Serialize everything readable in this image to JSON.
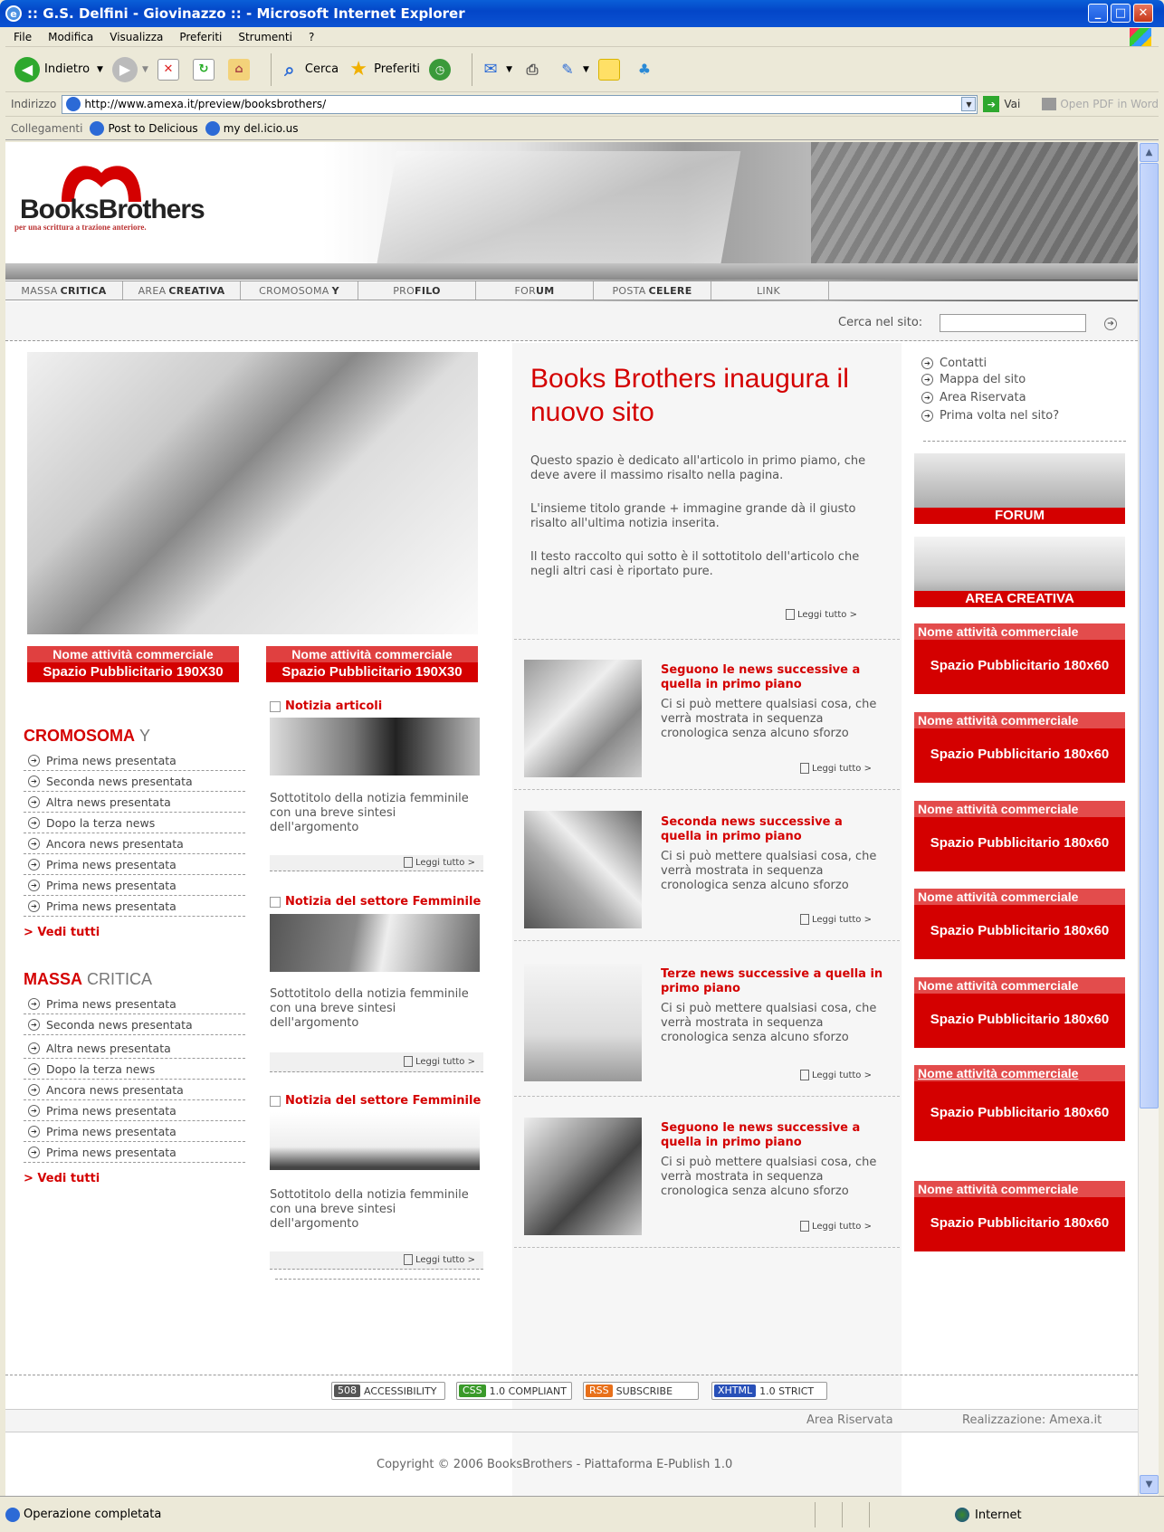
{
  "window": {
    "title": ":: G.S. Delfini - Giovinazzo :: - Microsoft Internet Explorer"
  },
  "menu": [
    "File",
    "Modifica",
    "Visualizza",
    "Preferiti",
    "Strumenti",
    "?"
  ],
  "toolbar": {
    "back": "Indietro",
    "search": "Cerca",
    "favorites": "Preferiti"
  },
  "address": {
    "label": "Indirizzo",
    "url": "http://www.amexa.it/preview/booksbrothers/",
    "go": "Vai",
    "pdf": "Open PDF in Word"
  },
  "links": {
    "label": "Collegamenti",
    "items": [
      "Post to Delicious",
      "my del.icio.us"
    ]
  },
  "site": {
    "logo": "BooksBrothers",
    "tagline": "per una scrittura a trazione anteriore.",
    "nav": [
      {
        "light": "MASSA",
        "bold": "CRITICA"
      },
      {
        "light": "AREA",
        "bold": "CREATIVA"
      },
      {
        "light": "CROMOSOMA",
        "bold": "Y"
      },
      {
        "light": "PRO",
        "bold": "FILO"
      },
      {
        "light": "FOR",
        "bold": "UM"
      },
      {
        "light": "POSTA",
        "bold": "CELERE"
      },
      {
        "light": "LINK",
        "bold": ""
      }
    ],
    "search_label": "Cerca nel sito:"
  },
  "ads190": [
    {
      "l1": "Nome attività commerciale",
      "l2": "Spazio Pubblicitario 190X30"
    },
    {
      "l1": "Nome attività commerciale",
      "l2": "Spazio Pubblicitario 190X30"
    }
  ],
  "cromosoma": {
    "red": "CROMOSOMA",
    "grey": "Y",
    "items": [
      "Prima news presentata",
      "Seconda news presentata",
      "Altra news presentata",
      "Dopo la terza news",
      "Ancora news presentata",
      "Prima news presentata",
      "Prima news presentata",
      "Prima news presentata"
    ],
    "more": "> Vedi tutti"
  },
  "massa": {
    "red": "MASSA",
    "grey": "CRITICA",
    "items": [
      "Prima news presentata",
      "Seconda news presentata",
      "Altra news presentata",
      "Dopo la terza news",
      "Ancora news presentata",
      "Prima news presentata",
      "Prima news presentata",
      "Prima news presentata"
    ],
    "more": "> Vedi tutti"
  },
  "notizie": [
    {
      "title": "Notizia articoli",
      "sub": "Sottotitolo della notizia femminile con una breve sintesi dell'argomento",
      "more": "Leggi tutto >"
    },
    {
      "title": "Notizia del settore Femminile",
      "sub": "Sottotitolo della notizia femminile con una breve sintesi dell'argomento",
      "more": "Leggi tutto >"
    },
    {
      "title": "Notizia del settore Femminile",
      "sub": "Sottotitolo della notizia femminile con una breve sintesi dell'argomento",
      "more": "Leggi tutto >"
    }
  ],
  "main": {
    "title": "Books Brothers inaugura il nuovo sito",
    "p1": "Questo spazio è dedicato all'articolo in primo piamo, che deve avere il massimo risalto nella pagina.",
    "p2": "L'insieme titolo grande + immagine grande dà il giusto risalto all'ultima notizia inserita.",
    "p3": "Il testo raccolto qui sotto è il sottotitolo dell'articolo che negli altri casi è riportato pure.",
    "more": "Leggi tutto >"
  },
  "news": [
    {
      "title": "Seguono le news successive a quella in primo piano",
      "body": "Ci si può mettere qualsiasi cosa, che verrà mostrata in sequenza cronologica senza alcuno sforzo",
      "more": "Leggi tutto >"
    },
    {
      "title": "Seconda news successive a quella in primo piano",
      "body": "Ci si può mettere qualsiasi cosa, che verrà mostrata in sequenza cronologica senza alcuno sforzo",
      "more": "Leggi tutto >"
    },
    {
      "title": "Terze  news successive a quella in primo piano",
      "body": "Ci si può mettere qualsiasi cosa, che verrà mostrata in sequenza cronologica senza alcuno sforzo",
      "more": "Leggi tutto >"
    },
    {
      "title": "Seguono le news successive a quella in primo piano",
      "body": "Ci si può mettere qualsiasi cosa, che verrà mostrata in sequenza cronologica senza alcuno sforzo",
      "more": "Leggi tutto >"
    }
  ],
  "right_links": [
    "Contatti",
    "Mappa del sito",
    "Area Riservata",
    "Prima volta nel sito?"
  ],
  "right_img_banners": [
    "FORUM",
    "AREA CREATIVA"
  ],
  "ads180": [
    {
      "t": "Nome attività commerciale",
      "b": "Spazio Pubblicitario 180x60"
    },
    {
      "t": "Nome attività commerciale",
      "b": "Spazio Pubblicitario 180x60"
    },
    {
      "t": "Nome attività commerciale",
      "b": "Spazio Pubblicitario 180x60"
    },
    {
      "t": "Nome attività commerciale",
      "b": "Spazio Pubblicitario 180x60"
    },
    {
      "t": "Nome attività commerciale",
      "b": "Spazio Pubblicitario 180x60"
    },
    {
      "t": "Nome attività commerciale",
      "b": "Spazio Pubblicitario 180x60"
    },
    {
      "t": "Nome attività commerciale",
      "b": "Spazio Pubblicitario 180x60"
    }
  ],
  "badges": [
    {
      "k": "508",
      "v": "ACCESSIBILITY",
      "color": "#555555"
    },
    {
      "k": "CSS",
      "v": "1.0 COMPLIANT",
      "color": "#3a9a2a"
    },
    {
      "k": "RSS",
      "v": "SUBSCRIBE",
      "color": "#e8701a"
    },
    {
      "k": "XHTML",
      "v": "1.0 STRICT",
      "color": "#2850b8"
    }
  ],
  "footer": {
    "area": "Area Riservata",
    "credit": "Realizzazione: Amexa.it",
    "copyright": "Copyright © 2006 BooksBrothers - Piattaforma E-Publish 1.0"
  },
  "status": {
    "text": "Operazione completata",
    "zone": "Internet"
  },
  "colors": {
    "accent": "#d40000",
    "titlebar": "#0346c8"
  }
}
